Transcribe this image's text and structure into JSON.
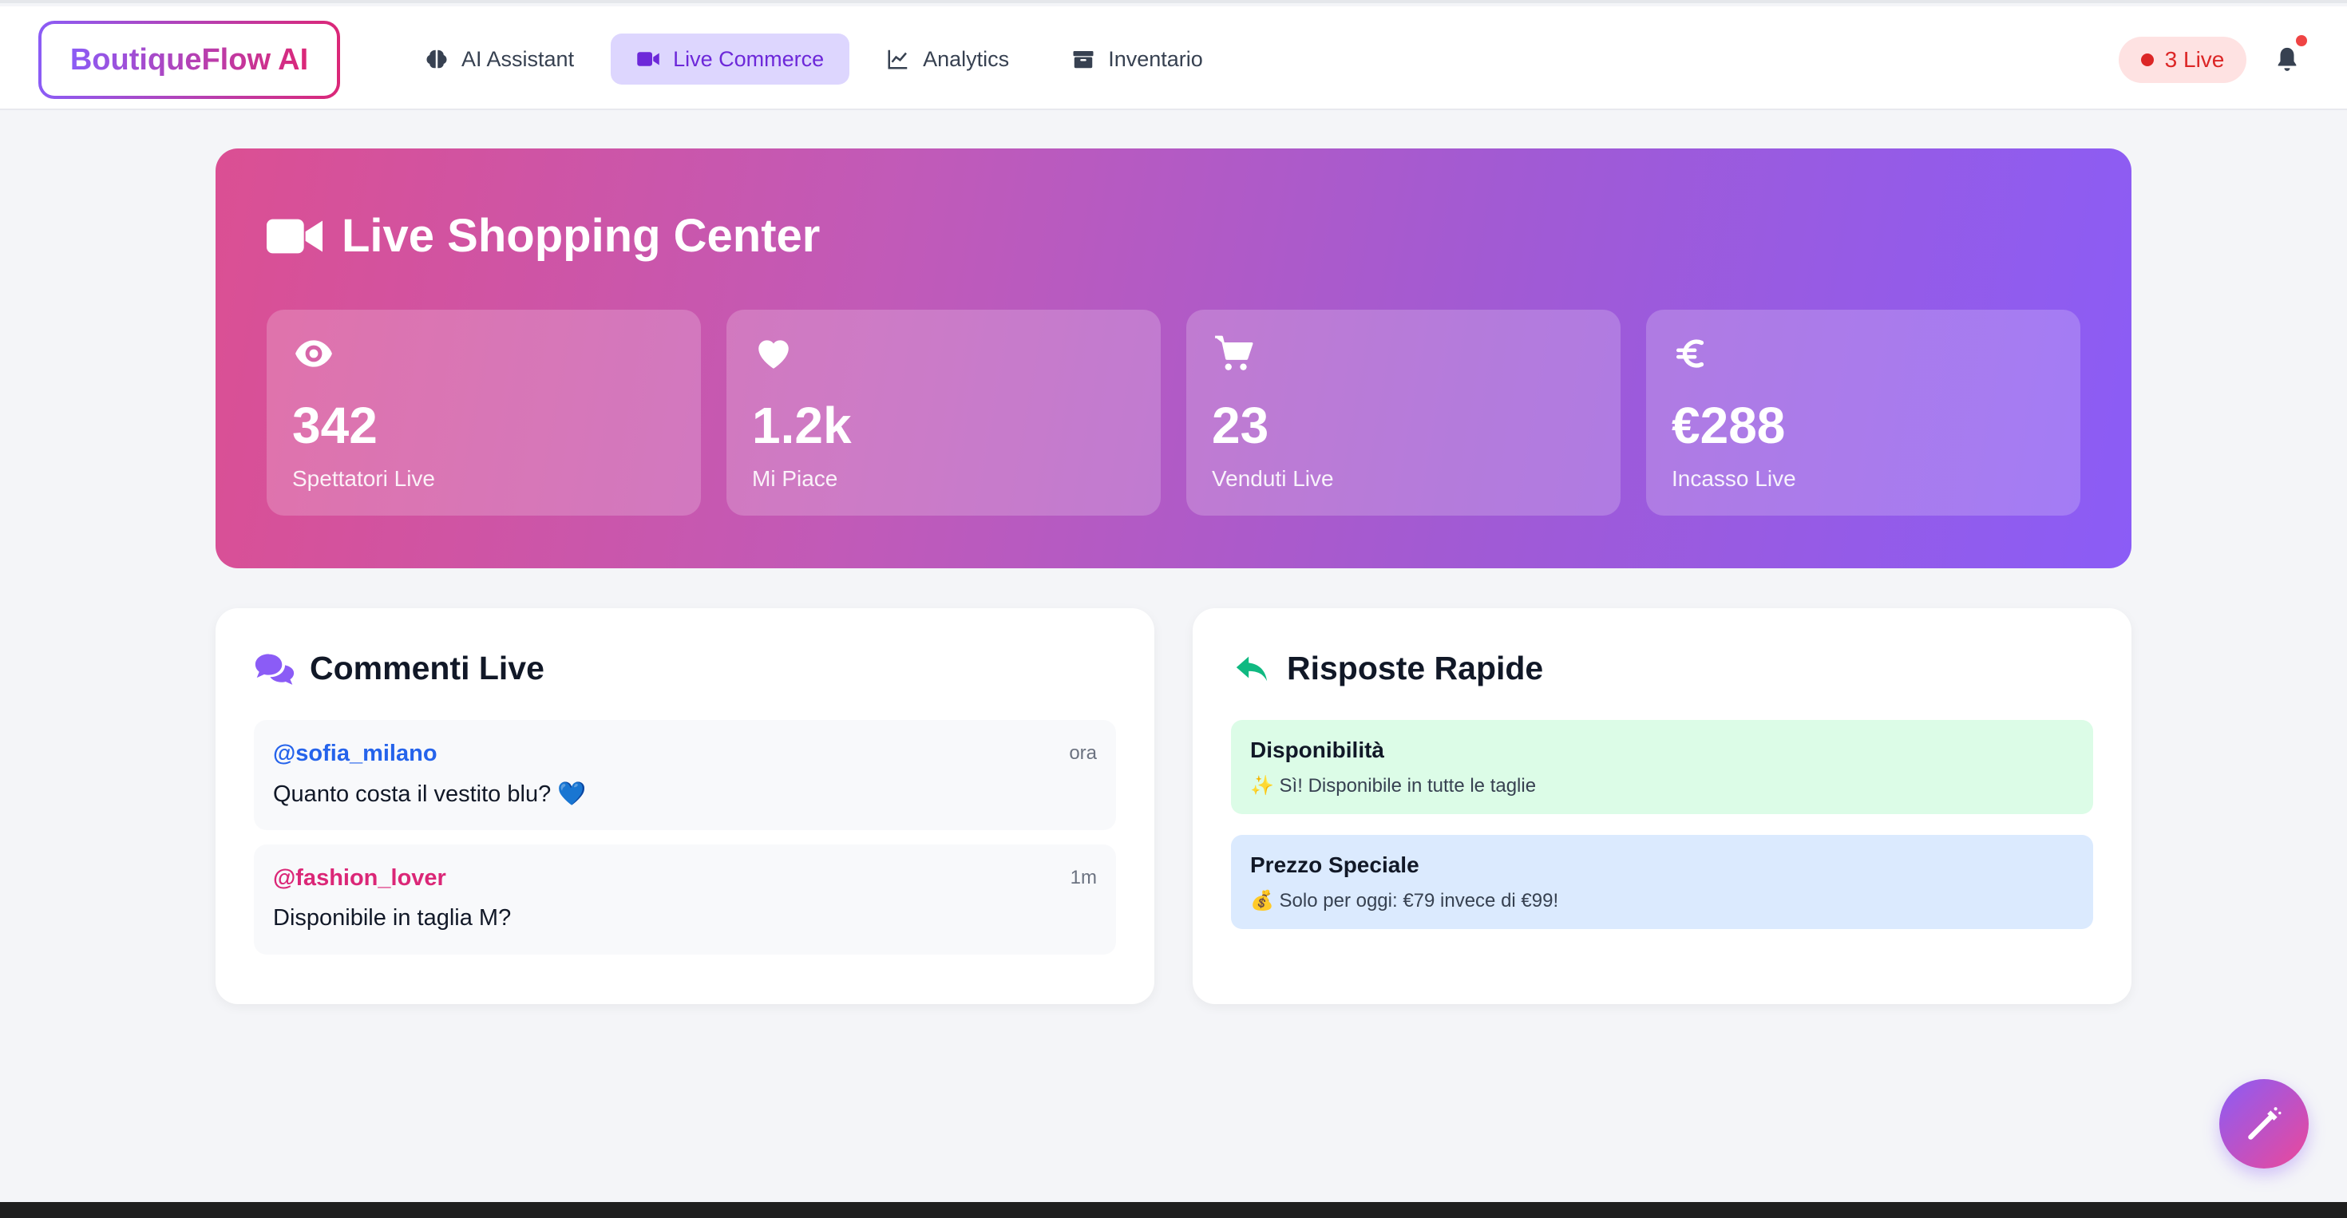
{
  "header": {
    "brand": "BoutiqueFlow AI",
    "nav": [
      {
        "label": "AI Assistant",
        "icon": "brain-icon"
      },
      {
        "label": "Live Commerce",
        "icon": "video-camera-icon",
        "active": true
      },
      {
        "label": "Analytics",
        "icon": "line-chart-icon"
      },
      {
        "label": "Inventario",
        "icon": "box-icon"
      }
    ],
    "live_badge": "3 Live"
  },
  "hero": {
    "title": "Live Shopping Center",
    "stats": [
      {
        "icon": "eye-icon",
        "value": "342",
        "label": "Spettatori Live"
      },
      {
        "icon": "heart-icon",
        "value": "1.2k",
        "label": "Mi Piace"
      },
      {
        "icon": "cart-icon",
        "value": "23",
        "label": "Venduti Live"
      },
      {
        "icon": "euro-icon",
        "value": "€288",
        "label": "Incasso Live"
      }
    ]
  },
  "comments": {
    "title": "Commenti Live",
    "items": [
      {
        "user": "@sofia_milano",
        "time": "ora",
        "text": "Quanto costa il vestito blu? 💙",
        "color": "#2563eb"
      },
      {
        "user": "@fashion_lover",
        "time": "1m",
        "text": "Disponibile in taglia M?",
        "color": "#db2777"
      }
    ]
  },
  "quick_replies": {
    "title": "Risposte Rapide",
    "items": [
      {
        "title": "Disponibilità",
        "body": "✨ Sì! Disponibile in tutte le taglie",
        "bg": "#dcfce7"
      },
      {
        "title": "Prezzo Speciale",
        "body": "💰 Solo per oggi: €79 invece di €99!",
        "bg": "#dbeafe"
      }
    ]
  },
  "colors": {
    "accent": "#8b5cf6",
    "pink": "#db2777",
    "live": "#dc2626",
    "reply_icon": "#10b981"
  }
}
